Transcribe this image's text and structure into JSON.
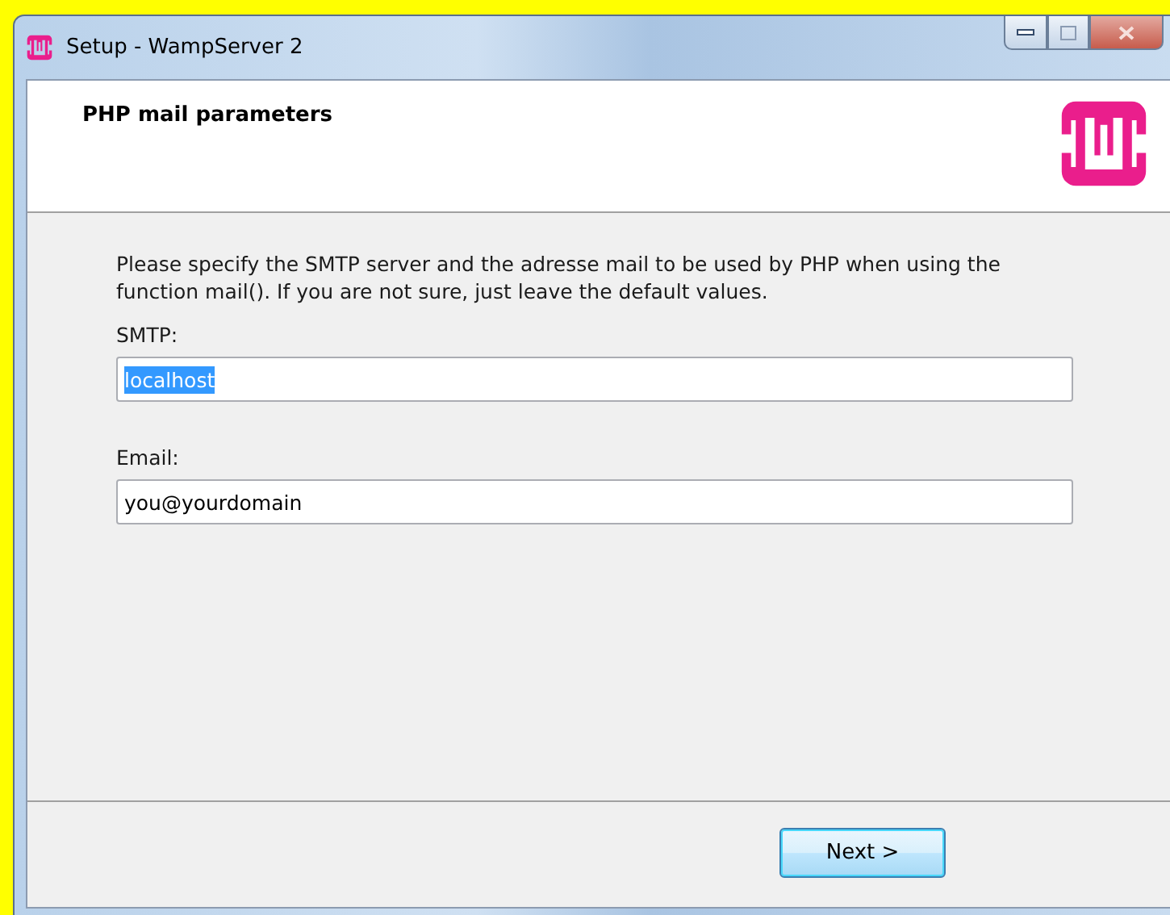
{
  "window": {
    "title": "Setup - WampServer 2"
  },
  "header": {
    "title": "PHP mail parameters"
  },
  "intro": "Please specify the SMTP server and the adresse mail to be used by PHP when using the function mail(). If you are not sure, just leave the default values.",
  "fields": [
    {
      "label": "SMTP:",
      "value": "localhost",
      "text_selected": true
    },
    {
      "label": "Email:",
      "value": "you@yourdomain",
      "text_selected": false
    }
  ],
  "buttons": [
    {
      "label": "Next >",
      "focused": true
    }
  ]
}
